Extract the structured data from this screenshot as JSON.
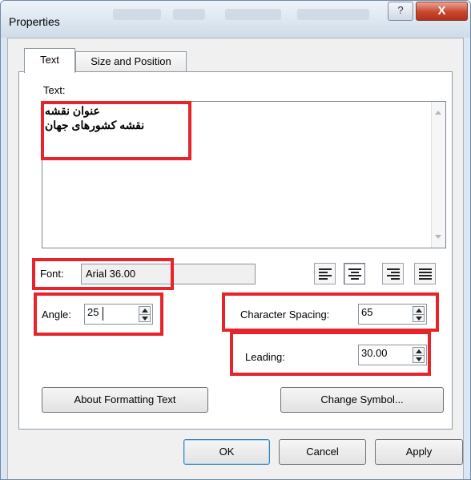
{
  "window": {
    "title": "Properties",
    "help_glyph": "?",
    "close_glyph": "X",
    "accent_highlight_color": "#e62429"
  },
  "tabs": [
    {
      "label": "Text",
      "active": true
    },
    {
      "label": "Size and Position",
      "active": false
    }
  ],
  "text_section": {
    "label": "Text:",
    "lines": [
      "عنوان نقشه",
      "نقشه کشورهای جهان"
    ]
  },
  "font": {
    "label": "Font:",
    "value": "Arial 36.00"
  },
  "alignment": {
    "options": [
      "align-left-icon",
      "align-center-icon",
      "align-right-icon",
      "align-justify-icon"
    ],
    "selected": "align-center-icon"
  },
  "angle": {
    "label": "Angle:",
    "value": "25"
  },
  "character_spacing": {
    "label": "Character Spacing:",
    "value": "65"
  },
  "leading": {
    "label": "Leading:",
    "value": "30.00"
  },
  "buttons": {
    "about_formatting": "About Formatting Text",
    "change_symbol": "Change Symbol...",
    "ok": "OK",
    "cancel": "Cancel",
    "apply": "Apply"
  }
}
